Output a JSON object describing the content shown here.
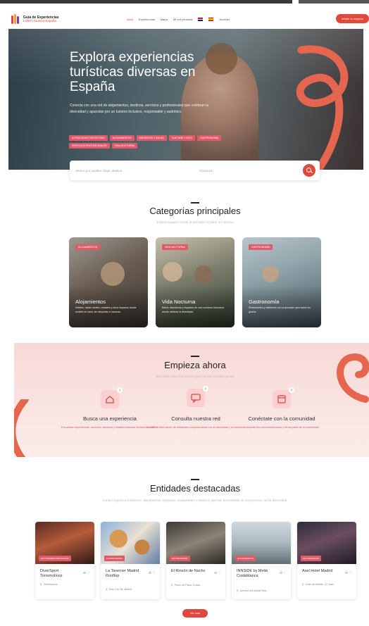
{
  "header": {
    "logo_line1": "Guía de Experiencias",
    "logo_line2": "LGBTI Turismo España",
    "nav": [
      "Inicio",
      "Experiencias",
      "Mapa",
      "Mi red personal"
    ],
    "login_label": "Acceder",
    "cta_label": "Añadir tu negocio"
  },
  "hero": {
    "title": "Explora experiencias turísticas diversas en España",
    "description": "Conecta con una red de alojamientos, destinos, servicios y profesionales que celebran la diversidad y apuestan por un turismo inclusivo, responsable y auténtico.",
    "tags": [
      "ACTIVIDADES DEPORTIVAS",
      "ALOJAMIENTOS",
      "BIENESTAR Y SALUD",
      "CULTURA Y OCIO",
      "GASTRONOMÍA",
      "SERVICIOS PROFESIONALES",
      "VIDA NOCTURNA"
    ]
  },
  "search": {
    "query_placeholder": "Busca por palabra clave, destino...",
    "location_placeholder": "Ubicación",
    "button_icon": "search-icon"
  },
  "categories": {
    "title": "Categorías principales",
    "subtitle": "Explora lugares donde la inclusión es parte del destino",
    "items": [
      {
        "badge": "ALOJAMIENTOS",
        "title": "Alojamientos",
        "desc": "Hoteles, casas rurales, hostales y otros espacios donde sentirte en casa, sin etiquetas ni barreras."
      },
      {
        "badge": "VIDA NOCTURNA",
        "title": "Vida Nocturna",
        "desc": "Bares, discotecas y espacios de ocio nocturno inclusivos donde celebrar la diversidad."
      },
      {
        "badge": "GASTRONOMÍA",
        "title": "Gastronomía",
        "desc": "Restaurantes y cafeterías con propuestas para todos los gustos."
      }
    ]
  },
  "start": {
    "title": "Empieza ahora",
    "subtitle": "Descubre cómo funciona la guía en tres sencillos pasos",
    "steps": [
      {
        "num": "1",
        "title": "Busca una experiencia",
        "desc": "Encuentra experiencias, servicios, destinos y establecimientos inclusivos LGBTI+."
      },
      {
        "num": "2",
        "title": "Consulta nuestra red",
        "desc": "Accede a información de entidades comprometidas con la diversidad y la inclusión."
      },
      {
        "num": "3",
        "title": "Conéctate con la comunidad",
        "desc": "Comparte tus recomendaciones y forma parte de la comunidad."
      }
    ]
  },
  "entities": {
    "title": "Entidades destacadas",
    "subtitle": "Conoce espacios inclusivos, alojamientos, agencias, restaurantes y destinos que han demostrado su compromiso con la diversidad.",
    "items": [
      {
        "badge": "ACTIVIDADES DEPORTIVAS",
        "name": "DiverSport Torremolinos",
        "location": "Torremolinos"
      },
      {
        "badge": "GASTRONOMÍA",
        "name": "La Taverner Madrid Rooftop",
        "location": "Gran Vía, 54, Madrid"
      },
      {
        "badge": "GASTRONOMÍA",
        "name": "El Rincón de Nacho",
        "location": "Paseo de Plaza, 8 local..."
      },
      {
        "badge": "ALOJAMIENTOS",
        "name": "INNSiDE by Meliá Costablanca",
        "location": "Avenida del Alcalde Mar..."
      },
      {
        "badge": "ALOJAMIENTOS",
        "name": "Axel Hotel Madrid",
        "location": "Calle del Infante, 12, Mad..."
      }
    ],
    "more_label": "Ver más"
  },
  "colors": {
    "accent": "#e0483c",
    "tag": "#e05a6a"
  }
}
